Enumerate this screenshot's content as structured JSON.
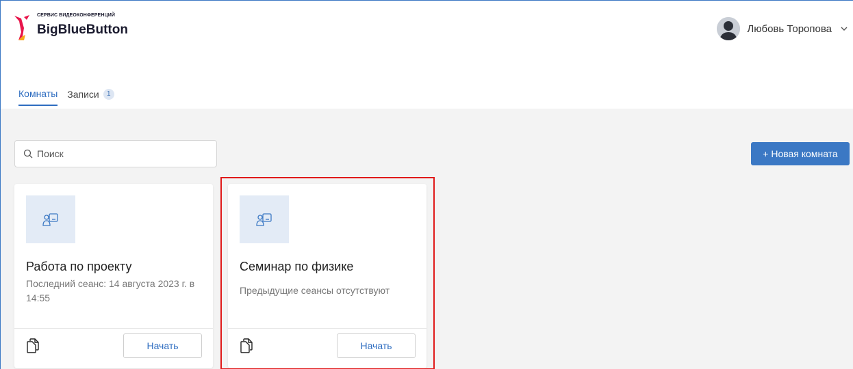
{
  "header": {
    "brand_subtitle": "СЕРВИС ВИДЕОКОНФЕРЕНЦИЙ",
    "brand_title": "BigBlueButton",
    "user_name": "Любовь Торопова",
    "user_menu_icon": "chevron-down-icon"
  },
  "tabs": [
    {
      "label": "Комнаты",
      "active": true
    },
    {
      "label": "Записи",
      "badge": "1",
      "active": false
    }
  ],
  "toolbar": {
    "search_placeholder": "Поиск",
    "new_room_label": "+ Новая комната"
  },
  "rooms": [
    {
      "title": "Работа по проекту",
      "subtitle": "Последний сеанс: 14 августа 2023 г. в 14:55",
      "start_label": "Начать"
    },
    {
      "title": "Семинар по физике",
      "subtitle": "Предыдущие сеансы отсутствуют",
      "start_label": "Начать"
    }
  ],
  "colors": {
    "accent": "#3b78c4",
    "highlight": "#e01919",
    "background": "#f3f3f3"
  }
}
